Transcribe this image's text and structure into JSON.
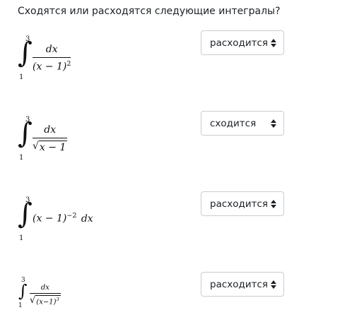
{
  "question": "Сходятся или расходятся следующие интегралы?",
  "items": [
    {
      "integral": {
        "upper": "3",
        "lower": "1",
        "numerator": "dx",
        "denominator": "(x − 1)",
        "denominator_exp": "2"
      },
      "select": {
        "value": "расходится",
        "icon": "up-down-caret-icon"
      }
    },
    {
      "integral": {
        "upper": "3",
        "lower": "1",
        "numerator": "dx",
        "radicand": "x − 1"
      },
      "select": {
        "value": "сходится",
        "icon": "up-down-caret-icon"
      }
    },
    {
      "integral": {
        "upper": "3",
        "lower": "1",
        "base": "(x − 1)",
        "exp": "−2",
        "differential": "dx"
      },
      "select": {
        "value": "расходится",
        "icon": "up-down-caret-icon"
      }
    },
    {
      "integral": {
        "upper": "3",
        "lower": "1",
        "numerator": "dx",
        "radicand": "(x−1)",
        "radicand_exp": "3"
      },
      "select": {
        "value": "расходится",
        "icon": "up-down-caret-icon"
      }
    }
  ]
}
